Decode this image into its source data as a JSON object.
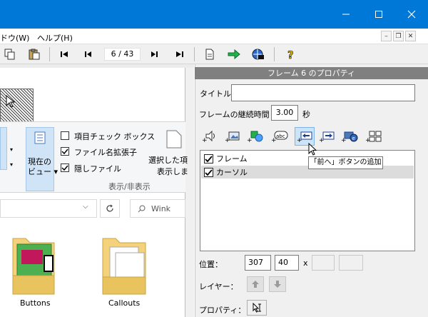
{
  "menubar": {
    "items": [
      {
        "label": "ドウ(W)"
      },
      {
        "label": "ヘルプ(H)"
      }
    ]
  },
  "toolbar": {
    "page_counter": "6 / 43"
  },
  "explorer": {
    "options": [
      {
        "label": "項目チェック ボックス",
        "checked": false
      },
      {
        "label": "ファイル名拡張子",
        "checked": true
      },
      {
        "label": "隠しファイル",
        "checked": true
      }
    ],
    "view_button_line1": "現在の",
    "view_button_line2": "ビュー",
    "selected_line1": "選択した項",
    "selected_line2": "表示しま",
    "group_label": "表示/非表示",
    "search_placeholder": "Wink",
    "files": [
      {
        "name": "Buttons"
      },
      {
        "name": "Callouts"
      }
    ]
  },
  "props": {
    "title": "フレーム 6 のプロパティ",
    "title_label": "タイトル",
    "title_value": "",
    "duration_label": "フレームの継続時間",
    "duration_value": "3.00",
    "duration_unit": "秒",
    "list_items": [
      {
        "label": "フレーム",
        "checked": true,
        "selected": false
      },
      {
        "label": "カーソル",
        "checked": true,
        "selected": true
      }
    ],
    "tooltip": "「前へ」ボタンの追加",
    "position_label": "位置：",
    "position_x": "307",
    "position_y": "40",
    "position_sep": "x",
    "size_w": "",
    "size_h": "",
    "layer_label": "レイヤー：",
    "property_label": "プロパティ："
  },
  "colors": {
    "titlebar": "#0078d7",
    "panel_title": "#808080",
    "selected_row": "#dcdcdc"
  }
}
